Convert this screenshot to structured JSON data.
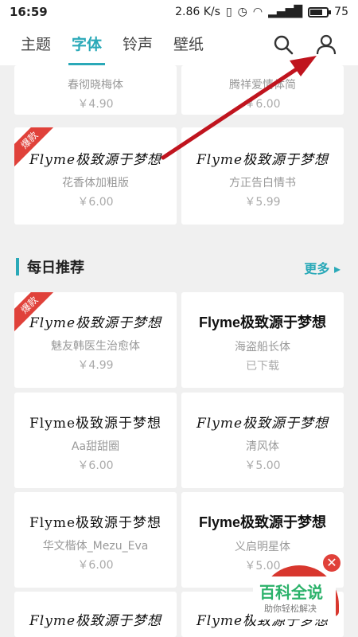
{
  "status": {
    "time": "16:59",
    "speed": "2.86 K/s",
    "battery": "75"
  },
  "tabs": [
    "主题",
    "字体",
    "铃声",
    "壁纸"
  ],
  "active_tab": "字体",
  "top_cards": [
    {
      "name": "春彻晓梅体",
      "price": "￥4.90"
    },
    {
      "name": "腾祥爱情体简",
      "price": "￥6.00"
    },
    {
      "preview": "Flyme极致源于梦想",
      "name": "花香体加粗版",
      "price": "￥6.00",
      "badge": "爆款"
    },
    {
      "preview": "Flyme极致源于梦想",
      "name": "方正告白情书",
      "price": "￥5.99"
    }
  ],
  "section": {
    "title": "每日推荐",
    "more": "更多"
  },
  "daily_cards": [
    {
      "preview": "Flyme极致源于梦想",
      "name": "魅友韩医生治愈体",
      "price": "￥4.99",
      "badge": "爆款"
    },
    {
      "preview": "Flyme极致源于梦想",
      "name": "海盗船长体",
      "price": "已下载"
    },
    {
      "preview": "Flyme极致源于梦想",
      "name": "Aa甜甜圈",
      "price": "￥6.00"
    },
    {
      "preview": "Flyme极致源于梦想",
      "name": "清风体",
      "price": "￥5.00"
    },
    {
      "preview": "Flyme极致源于梦想",
      "name": "华文楷体_Mezu_Eva",
      "price": "￥6.00"
    },
    {
      "preview": "Flyme极致源于梦想",
      "name": "义启明星体",
      "price": "￥5.00"
    },
    {
      "preview": "Flyme极致源于梦想"
    },
    {
      "preview": "Flyme极致源于梦想"
    }
  ],
  "overlay": {
    "brand": "百科全说",
    "sub": "助你轻松解决"
  },
  "colors": {
    "accent": "#2aa9b8",
    "badge": "#e0413a",
    "arrow": "#c0141e"
  }
}
